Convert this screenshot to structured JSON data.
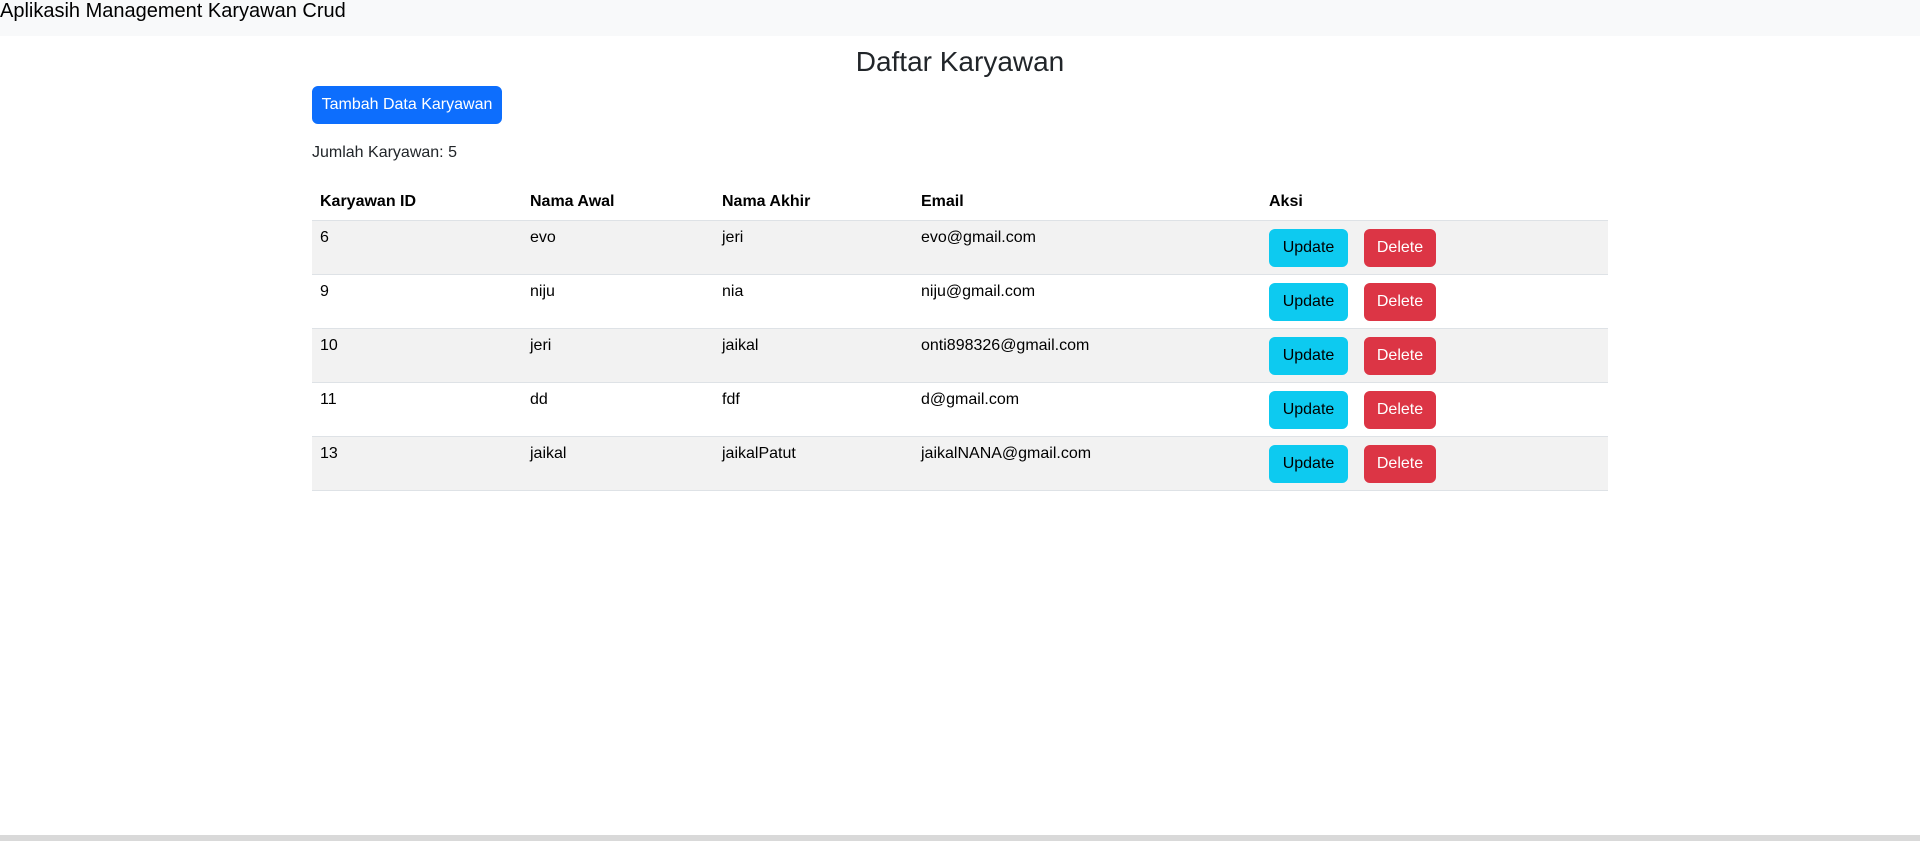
{
  "navbar": {
    "brand": "Aplikasih Management Karyawan Crud"
  },
  "page": {
    "title": "Daftar Karyawan",
    "add_button_label": "Tambah Data Karyawan",
    "count_label": "Jumlah Karyawan: 5"
  },
  "table": {
    "headers": [
      "Karyawan ID",
      "Nama Awal",
      "Nama Akhir",
      "Email",
      "Aksi"
    ],
    "rows": [
      {
        "id": "6",
        "first": "evo",
        "last": "jeri",
        "email": "evo@gmail.com"
      },
      {
        "id": "9",
        "first": "niju",
        "last": "nia",
        "email": "niju@gmail.com"
      },
      {
        "id": "10",
        "first": "jeri",
        "last": "jaikal",
        "email": "onti898326@gmail.com"
      },
      {
        "id": "11",
        "first": "dd",
        "last": "fdf",
        "email": "d@gmail.com"
      },
      {
        "id": "13",
        "first": "jaikal",
        "last": "jaikalPatut",
        "email": "jaikalNANA@gmail.com"
      }
    ],
    "update_label": "Update",
    "delete_label": "Delete"
  },
  "colors": {
    "primary": "#0d6efd",
    "info": "#0dcaf0",
    "danger": "#dc3545",
    "navbar_bg": "#f8f9fa",
    "stripe": "#f2f2f2"
  }
}
